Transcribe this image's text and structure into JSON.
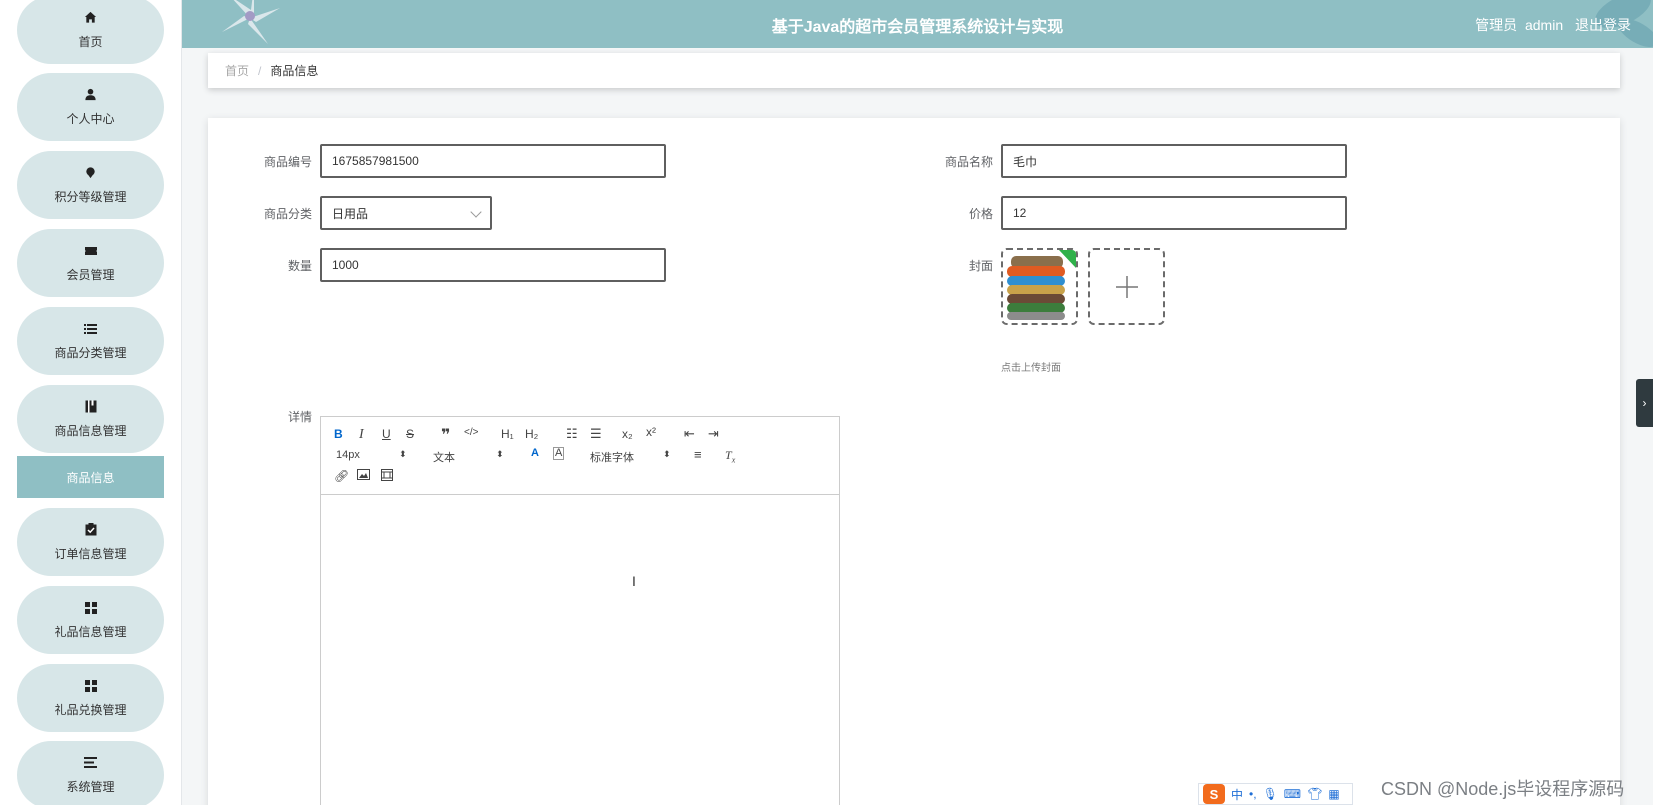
{
  "header": {
    "title": "基于Java的超市会员管理系统设计与实现",
    "role": "管理员",
    "username": "admin",
    "logout": "退出登录"
  },
  "sidebar": {
    "items": [
      {
        "label": "首页",
        "icon": "home-icon"
      },
      {
        "label": "个人中心",
        "icon": "user-icon"
      },
      {
        "label": "积分等级管理",
        "icon": "badge-icon"
      },
      {
        "label": "会员管理",
        "icon": "ticket-icon"
      },
      {
        "label": "商品分类管理",
        "icon": "list-icon"
      },
      {
        "label": "商品信息管理",
        "icon": "book-icon"
      },
      {
        "label": "订单信息管理",
        "icon": "clipboard-icon"
      },
      {
        "label": "礼品信息管理",
        "icon": "grid-icon"
      },
      {
        "label": "礼品兑换管理",
        "icon": "grid-icon"
      },
      {
        "label": "系统管理",
        "icon": "menu-icon"
      }
    ],
    "active_sub": "商品信息"
  },
  "breadcrumb": {
    "home": "首页",
    "separator": "/",
    "current": "商品信息"
  },
  "form": {
    "code_label": "商品编号",
    "code_value": "1675857981500",
    "name_label": "商品名称",
    "name_value": "毛巾",
    "category_label": "商品分类",
    "category_value": "日用品",
    "price_label": "价格",
    "price_value": "12",
    "quantity_label": "数量",
    "quantity_value": "1000",
    "cover_label": "封面",
    "cover_hint": "点击上传封面",
    "detail_label": "详情"
  },
  "editor": {
    "font_size": "14px",
    "block_type": "文本",
    "font_family": "标准字体"
  },
  "ime": {
    "mode": "中"
  },
  "watermark": "CSDN @Node.js毕设程序源码",
  "colors": {
    "header_bg": "#8fbfc4",
    "sidebar_item_bg": "#d7e6e8",
    "active_sub_bg": "#8fbfc4"
  }
}
